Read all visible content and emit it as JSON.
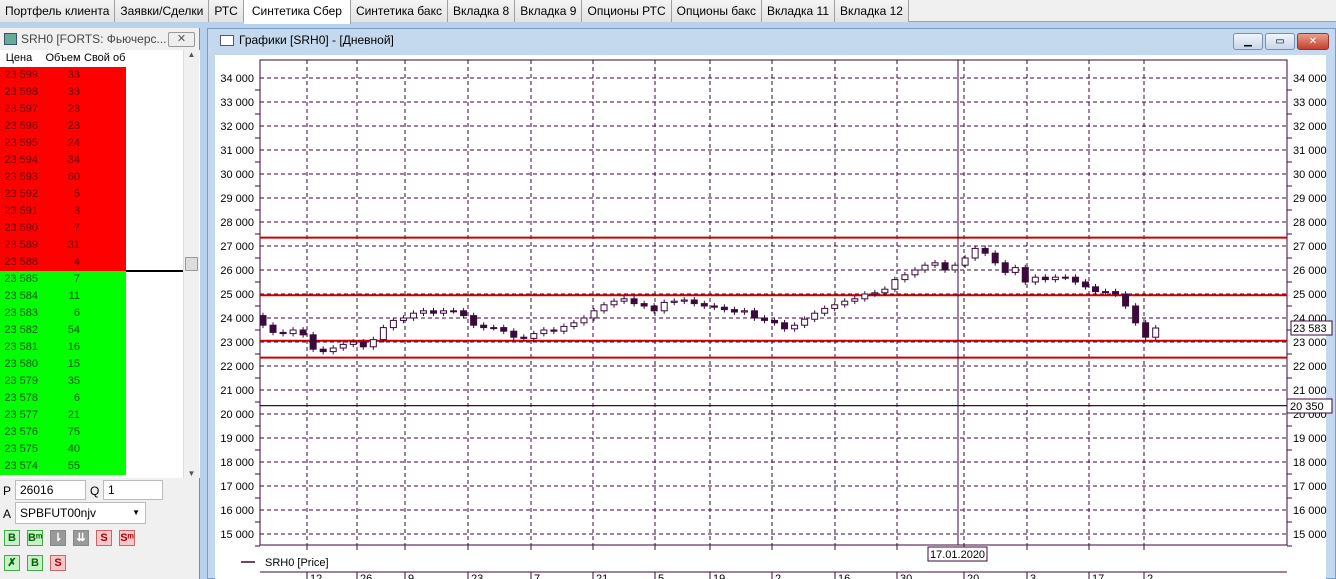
{
  "tabs": [
    "Портфель клиента",
    "Заявки/Сделки",
    "РТС",
    "Синтетика Сбер",
    "Синтетика бакс",
    "Вкладка 8",
    "Вкладка 9",
    "Опционы РТС",
    "Опционы бакс",
    "Вкладка 11",
    "Вкладка 12"
  ],
  "active_tab": 3,
  "orderbook": {
    "title": "SRH0 [FORTS: Фьючерс...",
    "close": "✕",
    "headers": [
      "Цена",
      "Объем",
      "Свой об"
    ],
    "sell": [
      [
        "23 599",
        "33"
      ],
      [
        "23 598",
        "33"
      ],
      [
        "23 597",
        "23"
      ],
      [
        "23 596",
        "23"
      ],
      [
        "23 595",
        "24"
      ],
      [
        "23 594",
        "34"
      ],
      [
        "23 593",
        "60"
      ],
      [
        "23 592",
        "5"
      ],
      [
        "23 591",
        "3"
      ],
      [
        "23 590",
        "7"
      ],
      [
        "23 589",
        "31"
      ],
      [
        "23 588",
        "4"
      ]
    ],
    "buy": [
      [
        "23 585",
        "7"
      ],
      [
        "23 584",
        "11"
      ],
      [
        "23 583",
        "6"
      ],
      [
        "23 582",
        "54"
      ],
      [
        "23 581",
        "16"
      ],
      [
        "23 580",
        "15"
      ],
      [
        "23 579",
        "35"
      ],
      [
        "23 578",
        "6"
      ],
      [
        "23 577",
        "21"
      ],
      [
        "23 576",
        "75"
      ],
      [
        "23 575",
        "40"
      ],
      [
        "23 574",
        "55"
      ]
    ]
  },
  "order_form": {
    "p_label": "P",
    "p_value": "26016",
    "q_label": "Q",
    "q_value": "1",
    "a_label": "A",
    "account": "SPBFUT00njv",
    "buttons": [
      "B",
      "Bᵐ",
      "⇂",
      "⇊",
      "S",
      "Sᵐ"
    ],
    "buttons2": [
      "✗",
      "B",
      "S"
    ]
  },
  "chart": {
    "window_title": "Графики [SRH0] - [Дневной]",
    "legend": "SRH0 [Price]",
    "crosshair_date": "17.01.2020",
    "last_price": "23 583",
    "level_label": "20 350",
    "colors": {
      "level": "#cc0000",
      "bear": "#3a0a3a",
      "grid": "#3a0a3a"
    }
  },
  "chart_data": {
    "type": "candlestick",
    "symbol": "SRH0",
    "ylim": [
      15000,
      34000
    ],
    "yticks": [
      "34 000",
      "33 000",
      "32 000",
      "31 000",
      "30 000",
      "29 000",
      "28 000",
      "27 000",
      "26 000",
      "25 000",
      "24 000",
      "23 000",
      "22 000",
      "21 000",
      "20 000",
      "19 000",
      "18 000",
      "17 000",
      "16 000",
      "15 000"
    ],
    "xticks": [
      "12",
      "26",
      "9",
      "23",
      "7",
      "21",
      "5",
      "19",
      "2",
      "16",
      "30",
      "20",
      "3",
      "17",
      "2"
    ],
    "first_open": 24100,
    "closes": [
      23700,
      23400,
      23350,
      23500,
      23300,
      22700,
      22600,
      22750,
      22900,
      23000,
      22800,
      23100,
      23600,
      23900,
      24000,
      24200,
      24300,
      24200,
      24300,
      24300,
      24100,
      23700,
      23600,
      23600,
      23450,
      23200,
      23150,
      23350,
      23500,
      23450,
      23650,
      23800,
      24000,
      24300,
      24550,
      24700,
      24800,
      24600,
      24500,
      24300,
      24650,
      24700,
      24750,
      24600,
      24500,
      24450,
      24350,
      24250,
      24300,
      24000,
      23900,
      23800,
      23550,
      23700,
      23950,
      24200,
      24400,
      24550,
      24700,
      24800,
      25000,
      25050,
      25200,
      25600,
      25800,
      26000,
      26200,
      26300,
      26000,
      26200,
      26500,
      26900,
      26700,
      26300,
      25900,
      26100,
      25500,
      25700,
      25600,
      25700,
      25700,
      25500,
      25300,
      25100,
      25100,
      25000,
      24500,
      23800,
      23200,
      23583
    ],
    "levels": [
      27350,
      24950,
      23050,
      22350
    ],
    "support_line": 20350
  }
}
